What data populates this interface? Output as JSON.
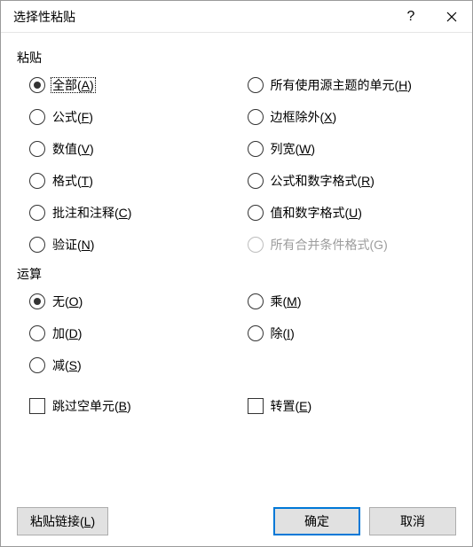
{
  "dialog": {
    "title": "选择性粘贴"
  },
  "groups": {
    "paste": {
      "label": "粘贴",
      "options": {
        "all": {
          "pre": "全部(",
          "key": "A",
          "post": ")"
        },
        "allThemed": {
          "pre": "所有使用源主题的单元(",
          "key": "H",
          "post": ")"
        },
        "formulas": {
          "pre": "公式(",
          "key": "F",
          "post": ")"
        },
        "noBorders": {
          "pre": "边框除外(",
          "key": "X",
          "post": ")"
        },
        "values": {
          "pre": "数值(",
          "key": "V",
          "post": ")"
        },
        "colWidths": {
          "pre": "列宽(",
          "key": "W",
          "post": ")"
        },
        "formats": {
          "pre": "格式(",
          "key": "T",
          "post": ")"
        },
        "formulasNumFmt": {
          "pre": "公式和数字格式(",
          "key": "R",
          "post": ")"
        },
        "comments": {
          "pre": "批注和注释(",
          "key": "C",
          "post": ")"
        },
        "valuesNumFmt": {
          "pre": "值和数字格式(",
          "key": "U",
          "post": ")"
        },
        "validation": {
          "pre": "验证(",
          "key": "N",
          "post": ")"
        },
        "allMergeCond": {
          "pre": "所有合并条件格式(",
          "key": "G",
          "post": ")"
        }
      }
    },
    "operation": {
      "label": "运算",
      "options": {
        "none": {
          "pre": "无(",
          "key": "O",
          "post": ")"
        },
        "mul": {
          "pre": "乘(",
          "key": "M",
          "post": ")"
        },
        "add": {
          "pre": "加(",
          "key": "D",
          "post": ")"
        },
        "div": {
          "pre": "除(",
          "key": "I",
          "post": ")"
        },
        "sub": {
          "pre": "减(",
          "key": "S",
          "post": ")"
        }
      }
    }
  },
  "checkboxes": {
    "skipBlanks": {
      "pre": "跳过空单元(",
      "key": "B",
      "post": ")"
    },
    "transpose": {
      "pre": "转置(",
      "key": "E",
      "post": ")"
    }
  },
  "buttons": {
    "pasteLink": {
      "pre": "粘贴链接(",
      "key": "L",
      "post": ")"
    },
    "ok": "确定",
    "cancel": "取消"
  }
}
